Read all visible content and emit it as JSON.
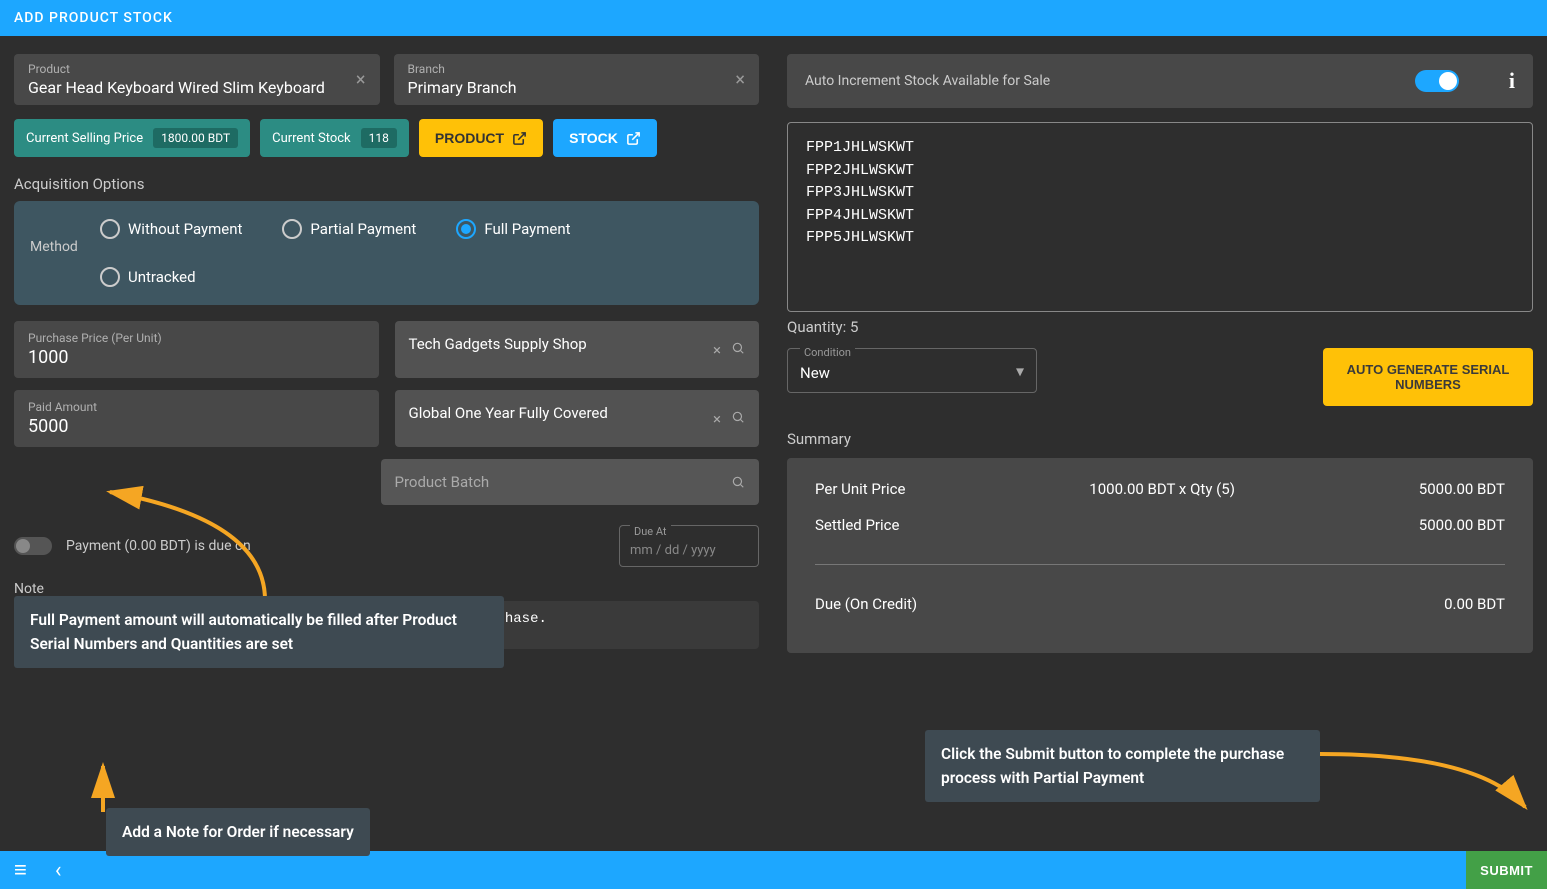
{
  "header": {
    "title": "ADD PRODUCT STOCK"
  },
  "product": {
    "label": "Product",
    "value": "Gear Head Keyboard Wired Slim Keyboard"
  },
  "branch": {
    "label": "Branch",
    "value": "Primary Branch"
  },
  "chips": {
    "selling_label": "Current Selling Price",
    "selling_value": "1800.00 BDT",
    "stock_label": "Current Stock",
    "stock_value": "118"
  },
  "buttons": {
    "product": "PRODUCT",
    "stock": "STOCK"
  },
  "acq_title": "Acquisition Options",
  "method": {
    "label": "Method",
    "opts": {
      "without": "Without Payment",
      "partial": "Partial Payment",
      "full": "Full Payment",
      "untracked": "Untracked"
    }
  },
  "purchase_price": {
    "label": "Purchase Price (Per Unit)",
    "value": "1000"
  },
  "supplier": {
    "value": "Tech Gadgets Supply Shop"
  },
  "paid_amount": {
    "label": "Paid Amount",
    "value": "5000"
  },
  "warranty": {
    "value": "Global One Year Fully Covered"
  },
  "batch": {
    "placeholder": "Product Batch"
  },
  "payment_due_label": "Payment (0.00 BDT) is due on",
  "due_at": {
    "label": "Due At",
    "placeholder": "mm / dd / yyyy"
  },
  "note": {
    "label": "Note",
    "value": "Full payment is being made with the Per Unit Product purchase."
  },
  "auto_inc": {
    "label": "Auto Increment Stock Available for Sale"
  },
  "serials": [
    "FPP1JHLWSKWT",
    "FPP2JHLWSKWT",
    "FPP3JHLWSKWT",
    "FPP4JHLWSKWT",
    "FPP5JHLWSKWT"
  ],
  "quantity_label": "Quantity: 5",
  "condition": {
    "label": "Condition",
    "value": "New"
  },
  "auto_gen_btn": "AUTO GENERATE SERIAL NUMBERS",
  "summary": {
    "title": "Summary",
    "per_unit_label": "Per Unit Price",
    "per_unit_calc": "1000.00 BDT x Qty (5)",
    "per_unit_total": "5000.00 BDT",
    "settled_label": "Settled Price",
    "settled_val": "5000.00 BDT",
    "due_label": "Due (On Credit)",
    "due_val": "0.00 BDT"
  },
  "submit": "SUBMIT",
  "callouts": {
    "payment_auto": "Full Payment amount will automatically be filled after Product Serial Numbers and Quantities are set",
    "note_hint": "Add a Note for Order if necessary",
    "submit_hint": "Click the Submit button to complete the purchase process with Partial Payment"
  }
}
